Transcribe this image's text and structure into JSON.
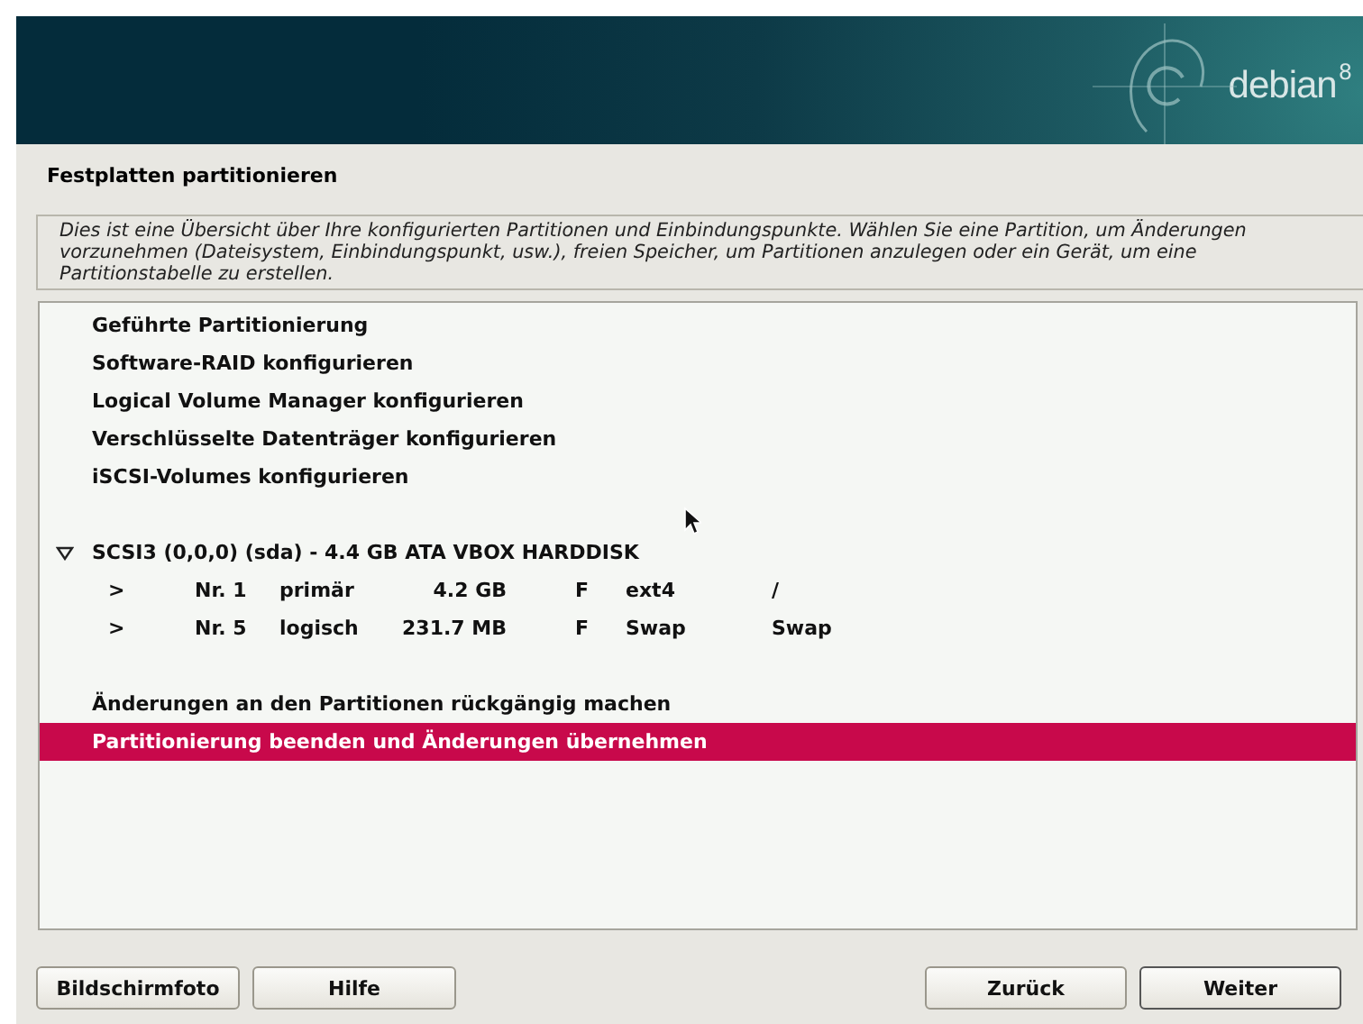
{
  "banner": {
    "logo": "debian",
    "version": "8"
  },
  "title": "Festplatten partitionieren",
  "description": "Dies ist eine Übersicht über Ihre konfigurierten Partitionen und Einbindungspunkte. Wählen Sie eine Partition, um Änderungen vorzunehmen (Dateisystem, Einbindungspunkt, usw.), freien Speicher, um Partitionen anzulegen oder ein Gerät, um eine Partitionstabelle zu erstellen.",
  "groups": [
    {
      "items": [
        {
          "kind": "action",
          "label": "Geführte Partitionierung",
          "selected": false
        },
        {
          "kind": "action",
          "label": "Software-RAID konfigurieren",
          "selected": false
        },
        {
          "kind": "action",
          "label": "Logical Volume Manager konfigurieren",
          "selected": false
        },
        {
          "kind": "action",
          "label": "Verschlüsselte Datenträger konfigurieren",
          "selected": false
        },
        {
          "kind": "action",
          "label": "iSCSI-Volumes konfigurieren",
          "selected": false
        }
      ]
    },
    {
      "items": [
        {
          "kind": "disk",
          "label": "SCSI3 (0,0,0) (sda) - 4.4 GB ATA VBOX HARDDISK",
          "expanded": true,
          "selected": false,
          "children": [
            {
              "marker": ">",
              "number": "Nr. 1",
              "type": "primär",
              "size": "4.2 GB",
              "flag": "F",
              "filesystem": "ext4",
              "mount": "/",
              "selected": false
            },
            {
              "marker": ">",
              "number": "Nr. 5",
              "type": "logisch",
              "size": "231.7 MB",
              "flag": "F",
              "filesystem": "Swap",
              "mount": "Swap",
              "selected": false
            }
          ]
        }
      ]
    },
    {
      "items": [
        {
          "kind": "action",
          "label": "Änderungen an den Partitionen rückgängig machen",
          "selected": false
        },
        {
          "kind": "action",
          "label": "Partitionierung beenden und Änderungen übernehmen",
          "selected": true
        }
      ]
    }
  ],
  "buttons_left": [
    "Bildschirmfoto",
    "Hilfe"
  ],
  "buttons_right": [
    "Zurück",
    "Weiter"
  ]
}
